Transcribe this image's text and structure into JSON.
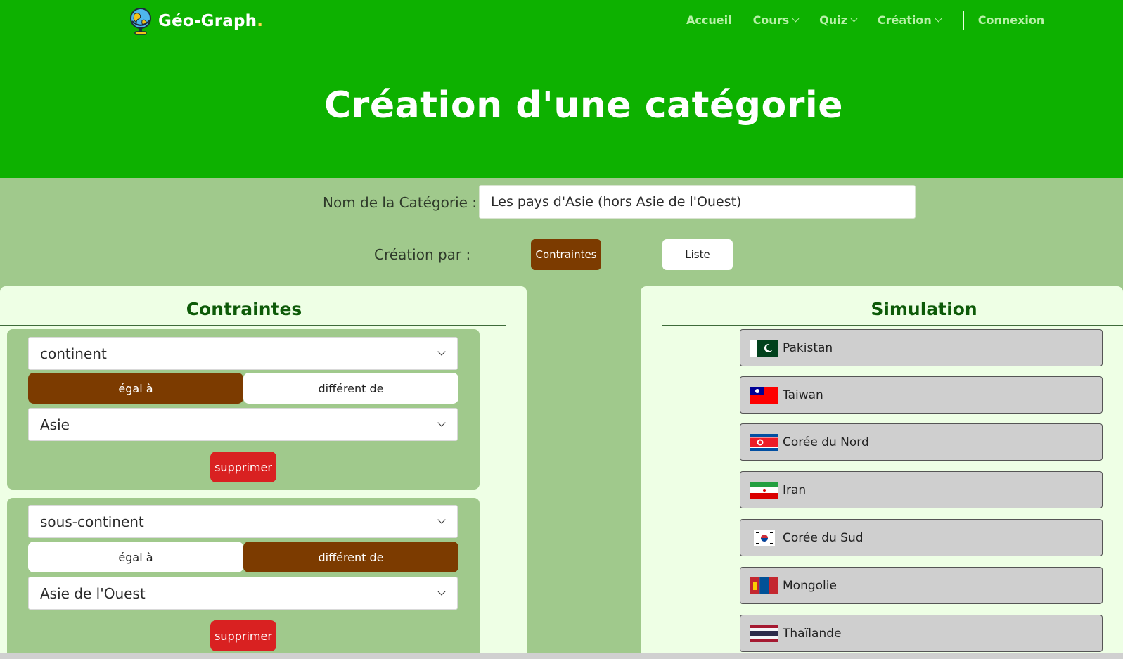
{
  "brand": {
    "name": "Géo-Graph",
    "dot": "."
  },
  "nav": {
    "items": [
      {
        "label": "Accueil",
        "dropdown": false
      },
      {
        "label": "Cours",
        "dropdown": true
      },
      {
        "label": "Quiz",
        "dropdown": true
      },
      {
        "label": "Création",
        "dropdown": true
      }
    ],
    "login": "Connexion"
  },
  "hero": {
    "title": "Création d'une catégorie"
  },
  "form": {
    "name_label": "Nom de la Catégorie :",
    "name_value": "Les pays d'Asie (hors Asie de l'Ouest)",
    "mode_label": "Création par :",
    "mode_constraints": "Contraintes",
    "mode_list": "Liste",
    "selected_mode": "Contraintes"
  },
  "constraints": {
    "title": "Contraintes",
    "items": [
      {
        "field": "continent",
        "eq_label": "égal à",
        "neq_label": "différent de",
        "selected": "eq",
        "value": "Asie",
        "delete_label": "supprimer"
      },
      {
        "field": "sous-continent",
        "eq_label": "égal à",
        "neq_label": "différent de",
        "selected": "neq",
        "value": "Asie de l'Ouest",
        "delete_label": "supprimer"
      }
    ]
  },
  "simulation": {
    "title": "Simulation",
    "countries": [
      {
        "name": "Pakistan",
        "flag": "pakistan-flag"
      },
      {
        "name": "Taiwan",
        "flag": "taiwan-flag"
      },
      {
        "name": "Corée du Nord",
        "flag": "north-korea-flag"
      },
      {
        "name": "Iran",
        "flag": "iran-flag"
      },
      {
        "name": "Corée du Sud",
        "flag": "south-korea-flag"
      },
      {
        "name": "Mongolie",
        "flag": "mongolia-flag"
      },
      {
        "name": "Thaïlande",
        "flag": "thailand-flag"
      }
    ]
  },
  "colors": {
    "primary_green": "#0db100",
    "form_bg": "#a0c98c",
    "panel_bg": "#eeffe5",
    "brown": "#7c3b00",
    "delete_red": "#d92121"
  }
}
